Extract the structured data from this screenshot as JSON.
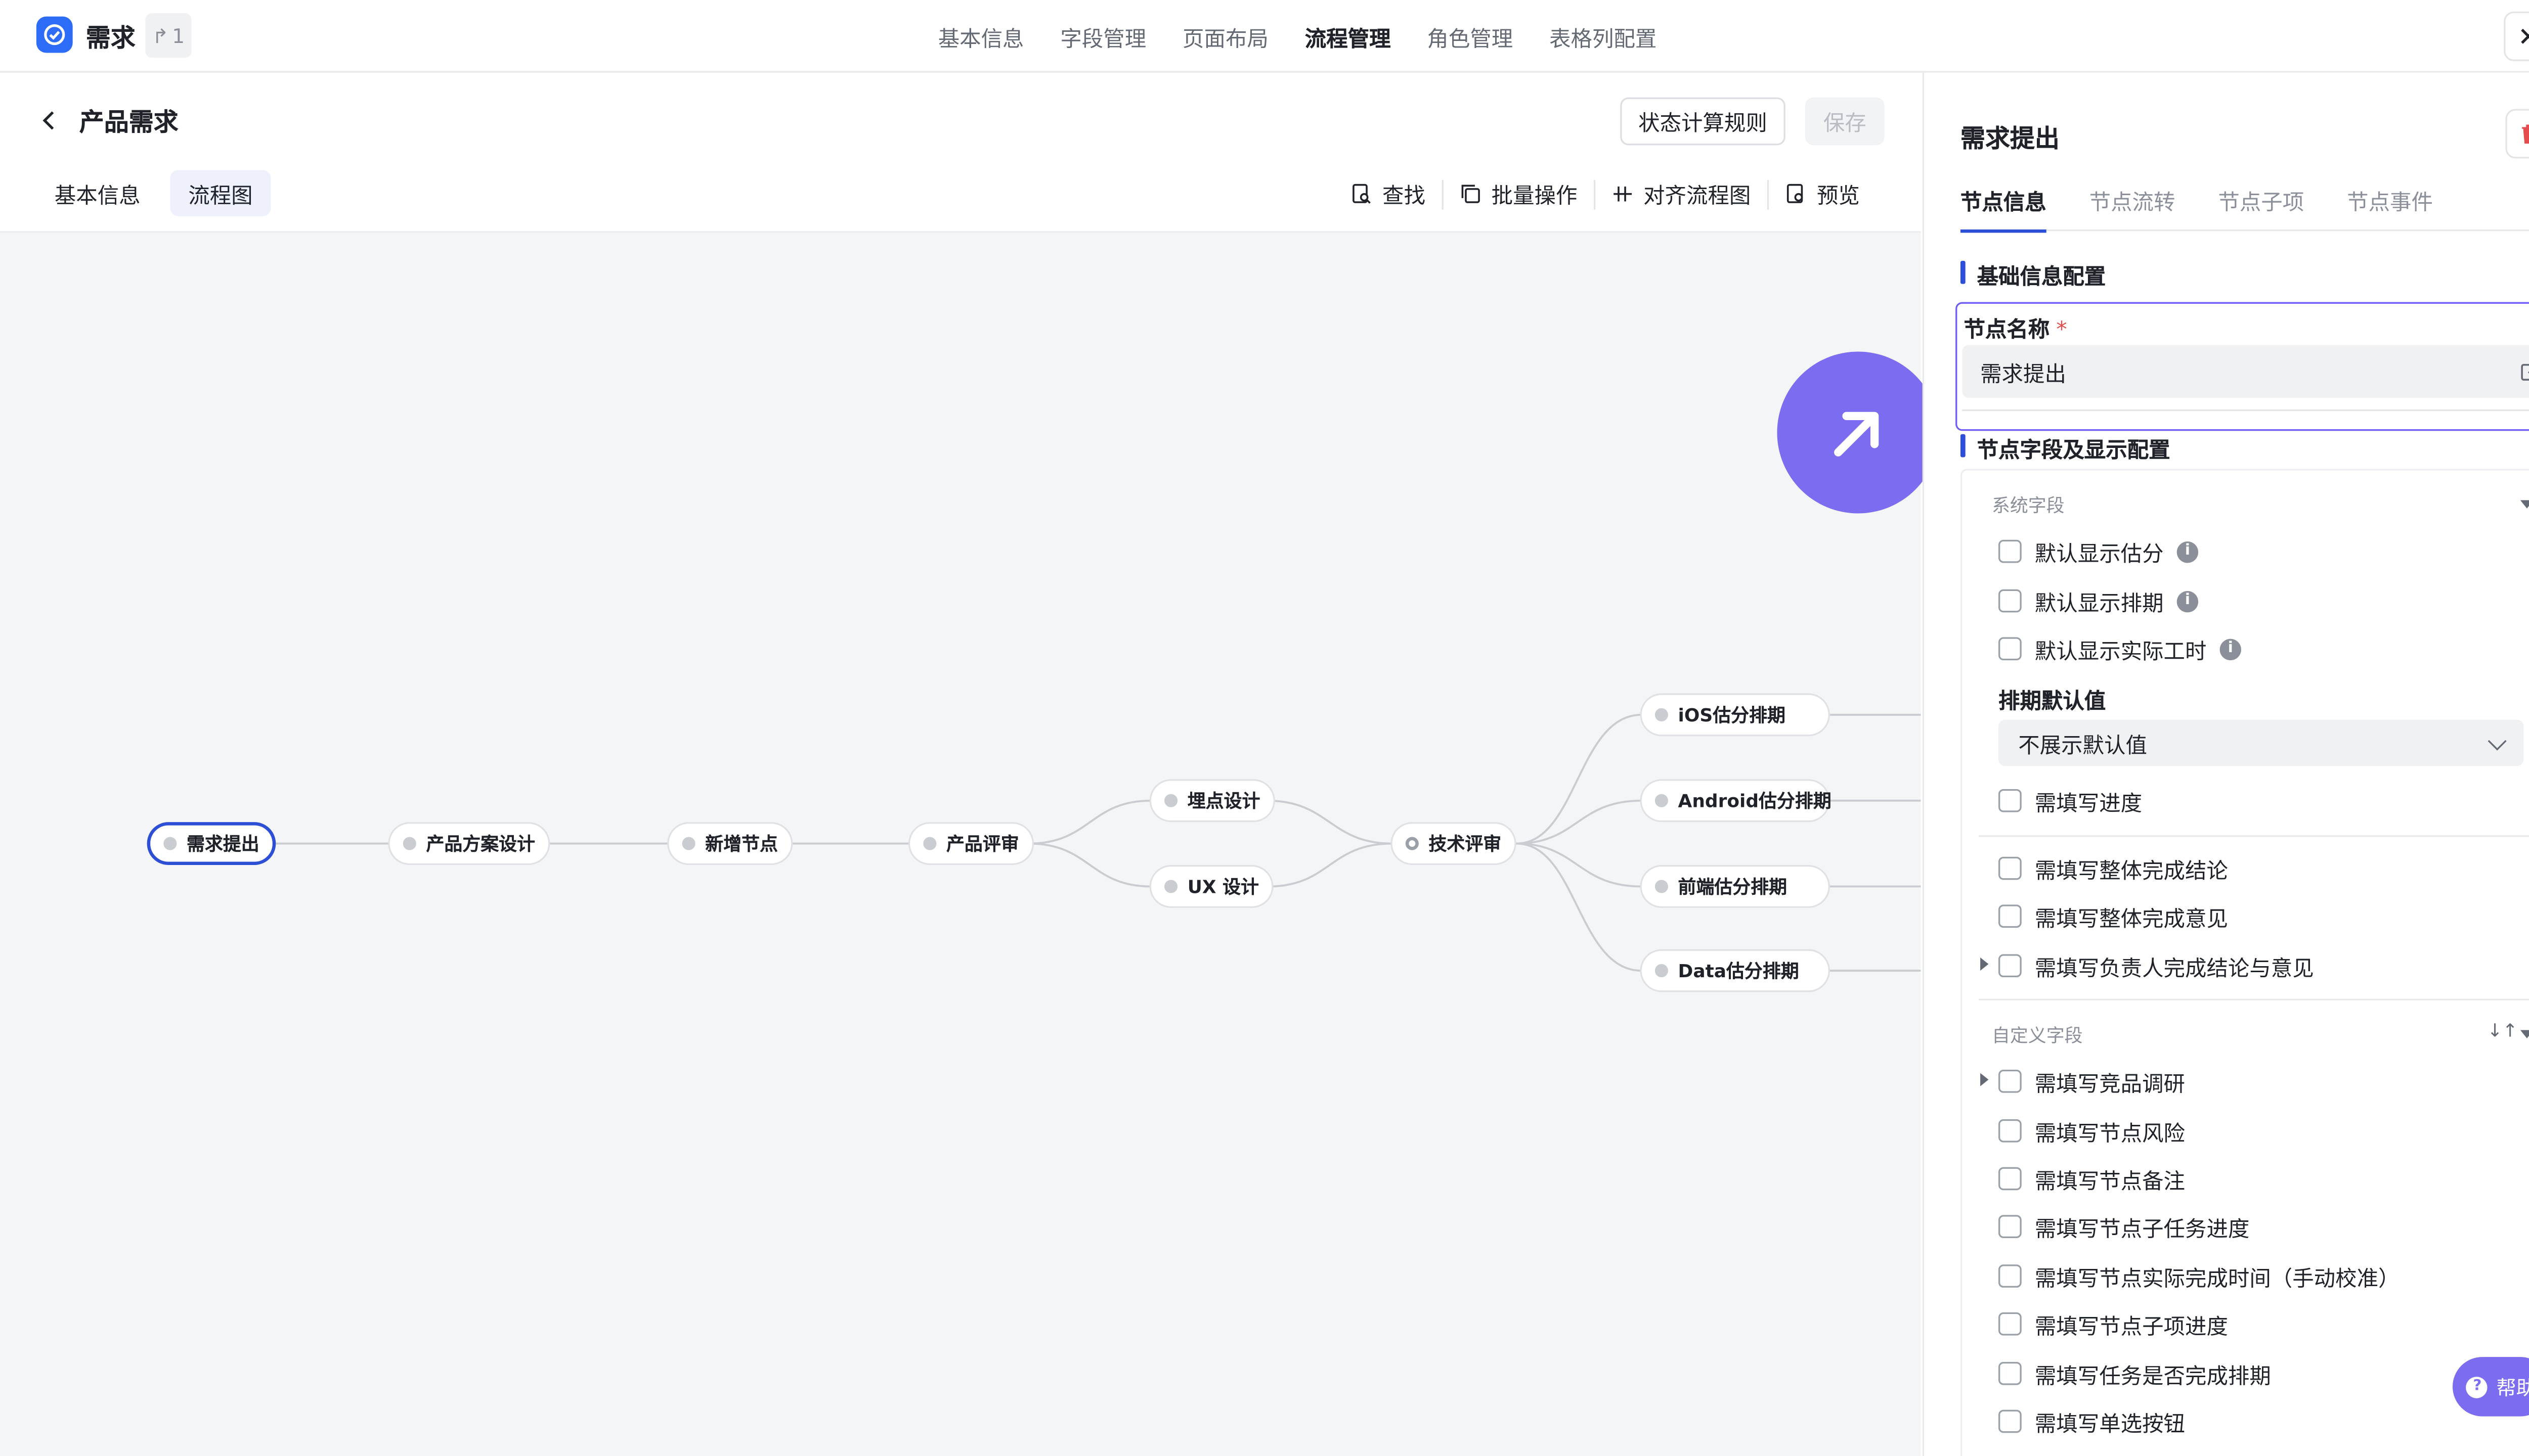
{
  "app": {
    "name": "需求",
    "share_count": "1"
  },
  "top_nav": [
    "基本信息",
    "字段管理",
    "页面布局",
    "流程管理",
    "角色管理",
    "表格列配置"
  ],
  "top_nav_active": "流程管理",
  "page": {
    "title": "产品需求",
    "rules_button": "状态计算规则",
    "save_button": "保存",
    "subtabs": [
      "基本信息",
      "流程图"
    ]
  },
  "toolbar": {
    "find": "查找",
    "batch": "批量操作",
    "align": "对齐流程图",
    "preview": "预览"
  },
  "flow_nodes": {
    "n1": "需求提出",
    "n2": "产品方案设计",
    "n3": "新增节点",
    "n4": "产品评审",
    "n5": "埋点设计",
    "n6": "UX 设计",
    "n7": "技术评审",
    "n8": "iOS估分排期",
    "n9": "Android估分排期",
    "n10": "前端估分排期",
    "n11": "Data估分排期"
  },
  "panel": {
    "title": "需求提出",
    "tabs": [
      "节点信息",
      "节点流转",
      "节点子项",
      "节点事件"
    ],
    "basic_section": "基础信息配置",
    "name_label": "节点名称",
    "required_mark": "*",
    "name_value": "需求提出",
    "fields_section": "节点字段及显示配置",
    "system_group": "系统字段",
    "system_fields": [
      "默认显示估分",
      "默认显示排期",
      "默认显示实际工时"
    ],
    "schedule_default_label": "排期默认值",
    "schedule_default_value": "不展示默认值",
    "progress_fields": [
      "需填写进度",
      "需填写整体完成结论",
      "需填写整体完成意见",
      "需填写负责人完成结论与意见"
    ],
    "custom_group": "自定义字段",
    "custom_fields": [
      "需填写竞品调研",
      "需填写节点风险",
      "需填写节点备注",
      "需填写节点子任务进度",
      "需填写节点实际完成时间（手动校准）",
      "需填写节点子项进度",
      "需填写任务是否完成排期",
      "需填写单选按钮"
    ]
  },
  "help": "帮助",
  "colors": {
    "accent": "#2c4fd6",
    "brand": "#2c6cf6",
    "fab": "#7b6cf0",
    "danger": "#e34d4d"
  }
}
